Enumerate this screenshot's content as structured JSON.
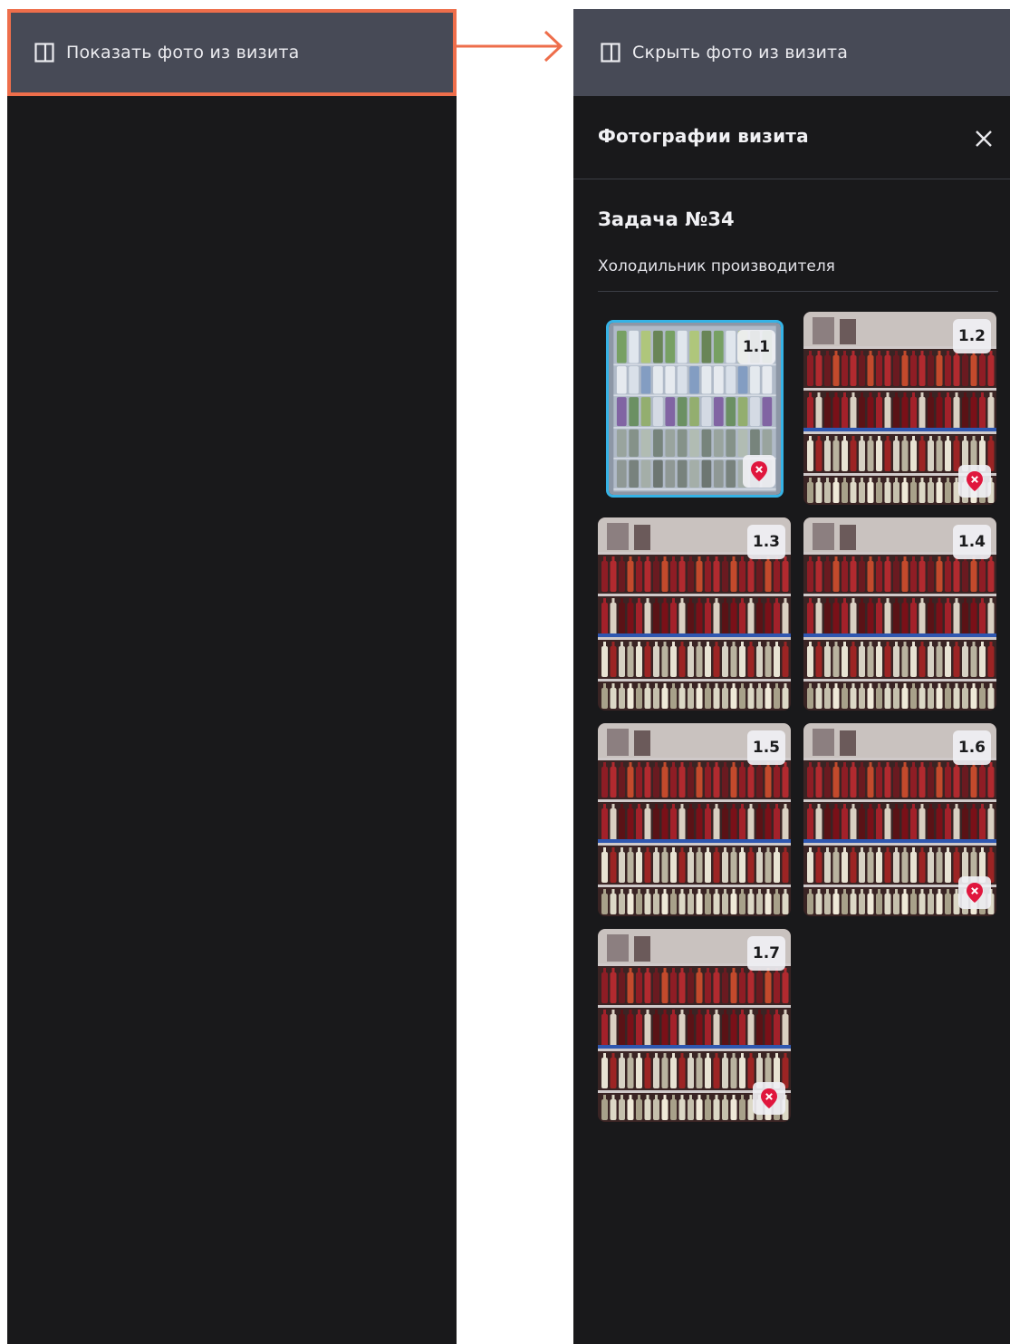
{
  "left_panel": {
    "toggle_label": "Показать фото из визита",
    "toggle_icon": "sidebar-panel-icon",
    "highlight_color": "#ee6e4b"
  },
  "transition_arrow_color": "#ee6e4b",
  "right_panel": {
    "toggle_label": "Скрыть фото из визита",
    "toggle_icon": "sidebar-panel-icon",
    "header_title": "Фотографии визита",
    "close_icon": "close-icon",
    "task_title": "Задача №34",
    "section_label": "Холодильник производителя",
    "selection_color": "#35b3e6",
    "pin_color": "#e0163d",
    "photos": [
      {
        "label": "1.1",
        "selected": true,
        "kind": "fridge",
        "pin": true
      },
      {
        "label": "1.2",
        "selected": false,
        "kind": "shelf",
        "pin": true
      },
      {
        "label": "1.3",
        "selected": false,
        "kind": "shelf",
        "pin": false
      },
      {
        "label": "1.4",
        "selected": false,
        "kind": "shelf",
        "pin": false
      },
      {
        "label": "1.5",
        "selected": false,
        "kind": "shelf",
        "pin": false
      },
      {
        "label": "1.6",
        "selected": false,
        "kind": "shelf",
        "pin": true
      },
      {
        "label": "1.7",
        "selected": false,
        "kind": "shelf",
        "pin": true
      }
    ]
  }
}
